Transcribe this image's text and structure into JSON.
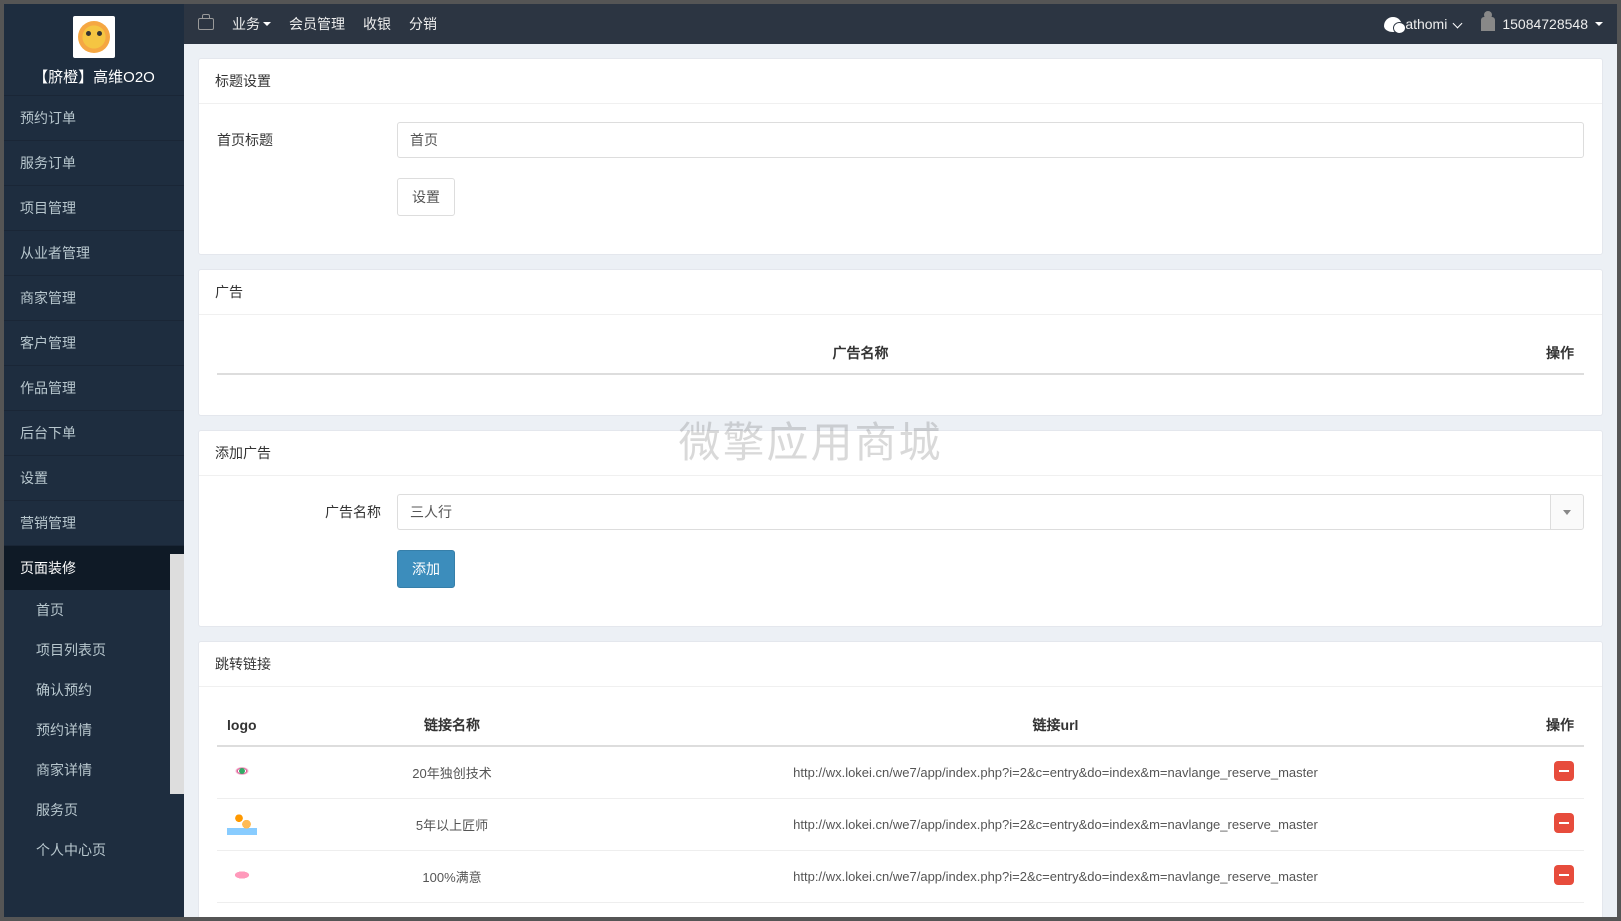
{
  "brand": {
    "name": "【脐橙】高维O2O"
  },
  "sidebar": {
    "items": [
      {
        "label": "预约订单"
      },
      {
        "label": "服务订单"
      },
      {
        "label": "项目管理"
      },
      {
        "label": "从业者管理"
      },
      {
        "label": "商家管理"
      },
      {
        "label": "客户管理"
      },
      {
        "label": "作品管理"
      },
      {
        "label": "后台下单"
      },
      {
        "label": "设置"
      },
      {
        "label": "营销管理"
      },
      {
        "label": "页面装修"
      }
    ],
    "sub": [
      {
        "label": "首页"
      },
      {
        "label": "项目列表页"
      },
      {
        "label": "确认预约"
      },
      {
        "label": "预约详情"
      },
      {
        "label": "商家详情"
      },
      {
        "label": "服务页"
      },
      {
        "label": "个人中心页"
      }
    ]
  },
  "topbar": {
    "business": "业务",
    "member": "会员管理",
    "checkout": "收银",
    "distribution": "分销",
    "account": "athomi",
    "phone": "15084728548"
  },
  "panels": {
    "title_settings": {
      "heading": "标题设置",
      "field_label": "首页标题",
      "field_value": "首页",
      "submit": "设置"
    },
    "ads": {
      "heading": "广告",
      "cols": {
        "name": "广告名称",
        "op": "操作"
      }
    },
    "ad_add": {
      "heading": "添加广告",
      "field_label": "广告名称",
      "field_value": "三人行",
      "submit": "添加"
    },
    "links": {
      "heading": "跳转链接",
      "cols": {
        "logo": "logo",
        "name": "链接名称",
        "url": "链接url",
        "op": "操作"
      },
      "rows": [
        {
          "icon": "eye",
          "name": "20年独创技术",
          "url": "http://wx.lokei.cn/we7/app/index.php?i=2&c=entry&do=index&m=navlange_reserve_master"
        },
        {
          "icon": "massage",
          "name": "5年以上匠师",
          "url": "http://wx.lokei.cn/we7/app/index.php?i=2&c=entry&do=index&m=navlange_reserve_master"
        },
        {
          "icon": "lips",
          "name": "100%满意",
          "url": "http://wx.lokei.cn/we7/app/index.php?i=2&c=entry&do=index&m=navlange_reserve_master"
        }
      ]
    }
  },
  "watermark": "微擎应用商城"
}
